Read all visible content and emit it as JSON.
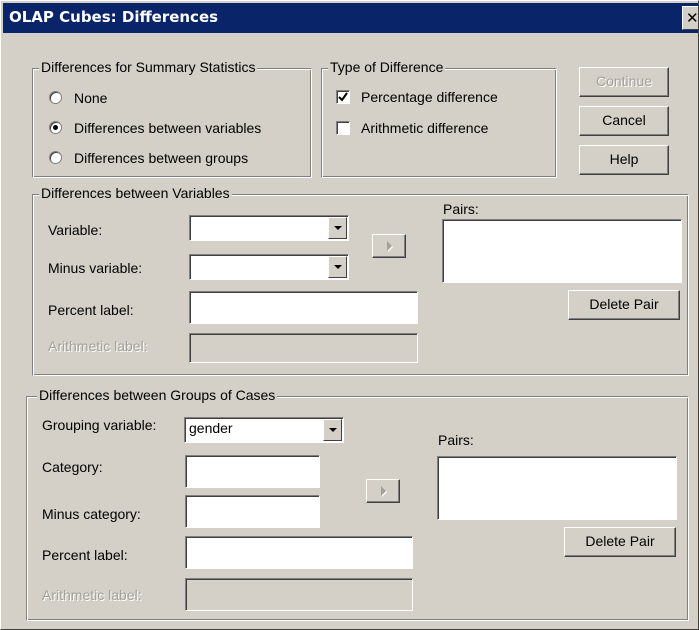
{
  "window": {
    "title": "OLAP Cubes: Differences",
    "close_glyph": "✕"
  },
  "summary_statistics": {
    "legend": "Differences for Summary Statistics",
    "options": [
      "None",
      "Differences between variables",
      "Differences between groups"
    ],
    "selected": "Differences between variables"
  },
  "type_of_difference": {
    "legend": "Type of Difference",
    "percentage_label": "Percentage difference",
    "percentage_checked": true,
    "arithmetic_label": "Arithmetic difference",
    "arithmetic_checked": false
  },
  "buttons": {
    "continue": "Continue",
    "cancel": "Cancel",
    "help": "Help"
  },
  "variables": {
    "legend": "Differences between Variables",
    "variable_label": "Variable:",
    "variable_value": "",
    "minus_variable_label": "Minus variable:",
    "minus_variable_value": "",
    "pairs_label": "Pairs:",
    "percent_label": "Percent label:",
    "percent_value": "",
    "arithmetic_label": "Arithmetic label:",
    "arithmetic_value": "",
    "delete_pair": "Delete Pair"
  },
  "groups": {
    "legend": "Differences between Groups of Cases",
    "grouping_variable_label": "Grouping variable:",
    "grouping_variable_value": "gender",
    "category_label": "Category:",
    "category_value": "",
    "minus_category_label": "Minus category:",
    "minus_category_value": "",
    "pairs_label": "Pairs:",
    "percent_label": "Percent label:",
    "percent_value": "",
    "arithmetic_label": "Arithmetic label:",
    "arithmetic_value": "",
    "delete_pair": "Delete Pair"
  },
  "icons": {
    "close": "close-icon",
    "dropdown": "chevron-down-icon",
    "move_right": "arrow-right-icon",
    "check": "checkmark-icon"
  },
  "colors": {
    "titlebar": "#0a246a",
    "face": "#d4d0c8",
    "disabled_text": "#a3a09a"
  }
}
